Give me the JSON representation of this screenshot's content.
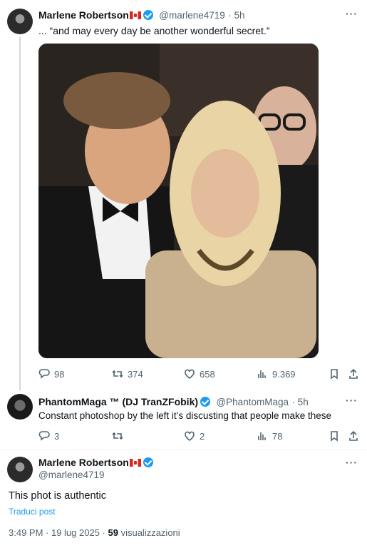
{
  "tweet1": {
    "name": "Marlene Robertson",
    "handle": "@marlene4719",
    "time": "· 5h",
    "text": "... “and may every day be another wonderful secret.”",
    "replies": "98",
    "retweets": "374",
    "likes": "658",
    "views": "9.369"
  },
  "reply1": {
    "name": "PhantomMaga ™ (DJ TranZFobik)",
    "handle": "@PhantomMaga",
    "time": "· 5h",
    "text": "Constant photoshop by the left it’s discusting that people make these",
    "replies": "3",
    "retweets": "",
    "likes": "2",
    "views": "78"
  },
  "main": {
    "name": "Marlene Robertson",
    "handle": "@marlene4719",
    "text": "This phot is authentic",
    "translate": "Traduci post",
    "timestamp": "3:49 PM · 19 lug 2025 · ",
    "views_count": "59",
    "views_label": "visualizzazioni"
  },
  "icons": {
    "reply": "reply-icon",
    "retweet": "retweet-icon",
    "like": "heart-icon",
    "views": "views-icon",
    "bookmark": "bookmark-icon",
    "share": "share-icon",
    "more": "more-icon"
  },
  "colors": {
    "accent": "#1d9bf0",
    "secondary_text": "#536471",
    "primary_text": "#0f1419"
  }
}
